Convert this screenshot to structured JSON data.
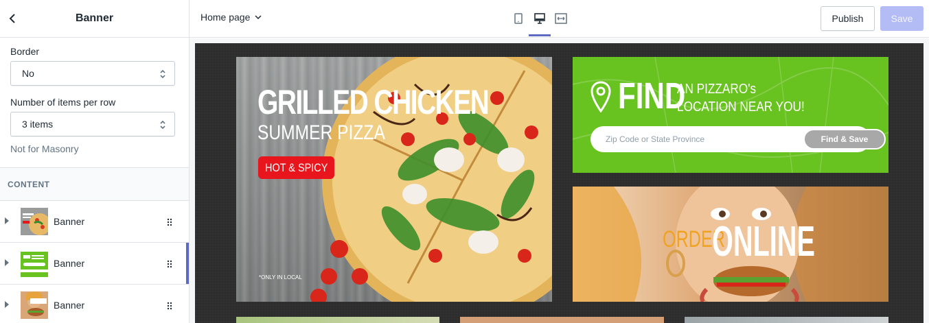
{
  "sidebar": {
    "title": "Banner",
    "border_label": "Border",
    "border_value": "No",
    "items_label": "Number of items per row",
    "items_value": "3 items",
    "items_help": "Not for Masonry",
    "content_heading": "CONTENT",
    "blocks": [
      {
        "label": "Banner"
      },
      {
        "label": "Banner",
        "active": true
      },
      {
        "label": "Banner"
      }
    ]
  },
  "topbar": {
    "page_select": "Home page",
    "publish_label": "Publish",
    "save_label": "Save"
  },
  "preview": {
    "banner1": {
      "title": "GRILLED CHICKEN",
      "subtitle": "SUMMER PIZZA",
      "badge": "HOT & SPICY",
      "note": "*ONLY IN LOCAL"
    },
    "banner2": {
      "find": "FIND",
      "tagline_1": "AN PIZZARO's",
      "tagline_2": "LOCATION NEAR YOU!",
      "input_placeholder": "Zip Code or State Province",
      "button_label": "Find & Save"
    },
    "banner3": {
      "order": "ORDER",
      "online": "ONLINE"
    }
  },
  "colors": {
    "accent": "#5c6ac4",
    "save_disabled": "#b3bcf5",
    "banner_green": "#68c21f",
    "badge_red": "#e8151c"
  }
}
